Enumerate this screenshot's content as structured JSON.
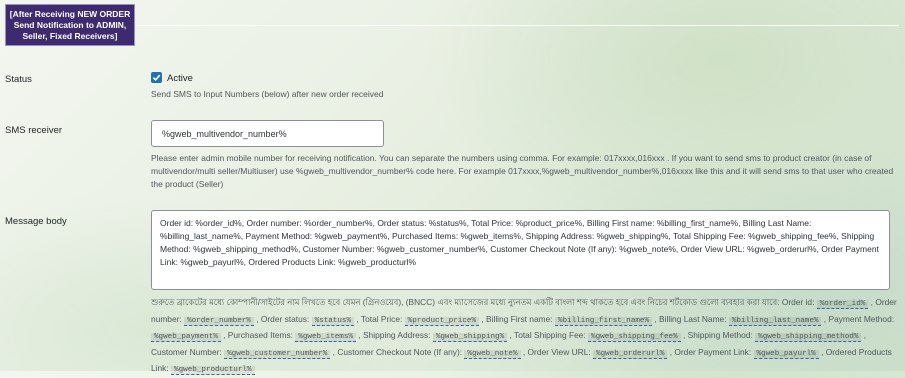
{
  "section": {
    "badge": "[After Receiving NEW ORDER Send Notification to ADMIN, Seller, Fixed Receivers]"
  },
  "status": {
    "label": "Status",
    "checkbox_label": "Active",
    "checked": true,
    "description": "Send SMS to Input Numbers (below) after new order received"
  },
  "sms_receiver": {
    "label": "SMS receiver",
    "value": "%gweb_multivendor_number%",
    "description": "Please enter admin mobile number for receiving notification. You can separate the numbers using comma. For example: 017xxxx,016xxx . If you want to send sms to product creator (in case of multivendor/multi seller/Multiuser) use %gweb_multivendor_number% code here. For example 017xxxx,%gweb_multivendor_number%,016xxxx like this and it will send sms to that user who created the product (Seller)"
  },
  "message_body": {
    "label": "Message body",
    "value": "Order id: %order_id%, Order number: %order_number%, Order status: %status%, Total Price: %product_price%, Billing First name: %billing_first_name%, Billing Last Name: %billing_last_name%, Payment Method: %gweb_payment%, Purchased Items: %gweb_items%, Shipping Address: %gweb_shipping%, Total Shipping Fee: %gweb_shipping_fee%, Shipping Method: %gweb_shipping_method%, Customer Number: %gweb_customer_number%, Customer Checkout Note (If any): %gweb_note%, Order View URL: %gweb_orderurl%, Order Payment Link: %gweb_payurl%, Ordered Products Link: %gweb_producturl%",
    "help_intro": "শুরুতে ব্রাকেটের মধ্যে কোম্পানী/সাইটের নাম লিখতে হবে যেমন (গ্রিনওয়েব), (BNCC) এবং ম্যাসেজের মধ্যে ন্যুনতম একটি বাংলা শব্দ থাকতে হবে এবং নিচের শর্টকোড গুলো ব্যবহার করা যাবে:",
    "shortcodes": [
      {
        "label": "Order id:",
        "code": "%order_id%"
      },
      {
        "label": "Order number:",
        "code": "%order_number%"
      },
      {
        "label": "Order status:",
        "code": "%status%"
      },
      {
        "label": "Total Price:",
        "code": "%product_price%"
      },
      {
        "label": "Billing First name:",
        "code": "%billing_first_name%"
      },
      {
        "label": "Billing Last Name:",
        "code": "%billing_last_name%"
      },
      {
        "label": "Payment Method:",
        "code": "%gweb_payment%"
      },
      {
        "label": "Purchased Items:",
        "code": "%gweb_items%"
      },
      {
        "label": "Shipping Address:",
        "code": "%gweb_shipping%"
      },
      {
        "label": "Total Shipping Fee:",
        "code": "%gweb_shipping_fee%"
      },
      {
        "label": "Shipping Method:",
        "code": "%gweb_shipping_method%"
      },
      {
        "label": "Customer Number:",
        "code": "%gweb_customer_number%"
      },
      {
        "label": "Customer Checkout Note (If any):",
        "code": "%gweb_note%"
      },
      {
        "label": "Order View URL:",
        "code": "%gweb_orderurl%"
      },
      {
        "label": "Order Payment Link:",
        "code": "%gweb_payurl%"
      },
      {
        "label": "Ordered Products Link:",
        "code": "%gweb_producturl%"
      }
    ]
  }
}
